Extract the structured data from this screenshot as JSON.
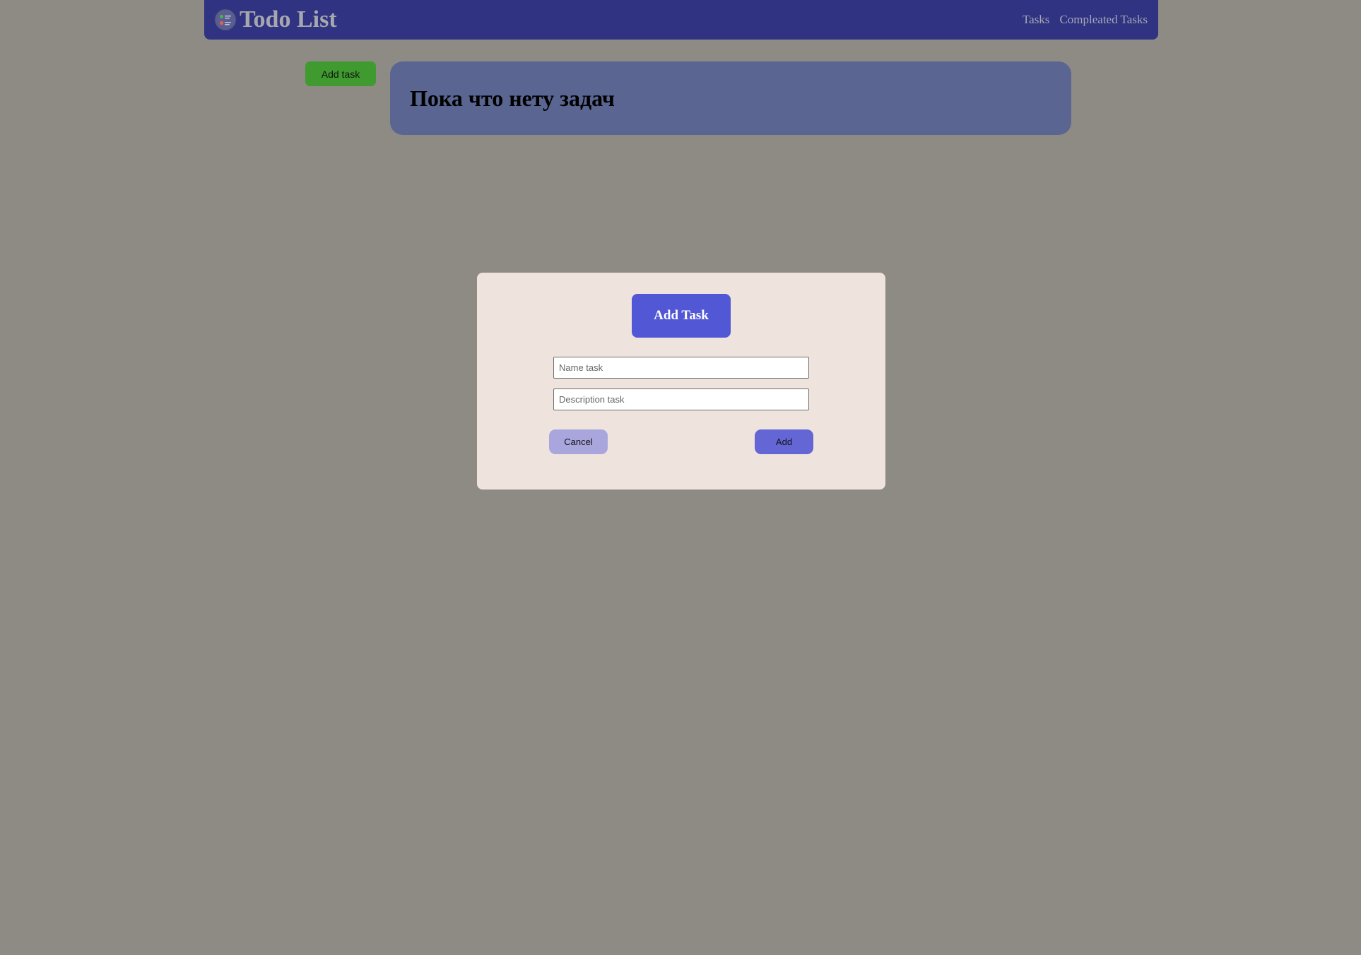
{
  "header": {
    "title": "Todo List",
    "logo_icon": "todo-list-logo-icon",
    "nav": [
      {
        "label": "Tasks"
      },
      {
        "label": "Compleated Tasks"
      }
    ],
    "colors": {
      "background": "#2f3382",
      "text": "#a7a7ad"
    }
  },
  "toolbar": {
    "add_task_label": "Add task",
    "add_task_color": "#3f9a2f"
  },
  "tasks_panel": {
    "empty_message": "Пока что нету задач",
    "color": "#5a6691"
  },
  "modal": {
    "title": "Add Task",
    "name_placeholder": "Name task",
    "name_value": "",
    "description_placeholder": "Description task",
    "description_value": "",
    "cancel_label": "Cancel",
    "add_label": "Add",
    "colors": {
      "background": "#efe4dd",
      "title_bg": "#5257d6",
      "cancel_bg": "#a9a6de",
      "add_bg": "#6466d6"
    }
  }
}
